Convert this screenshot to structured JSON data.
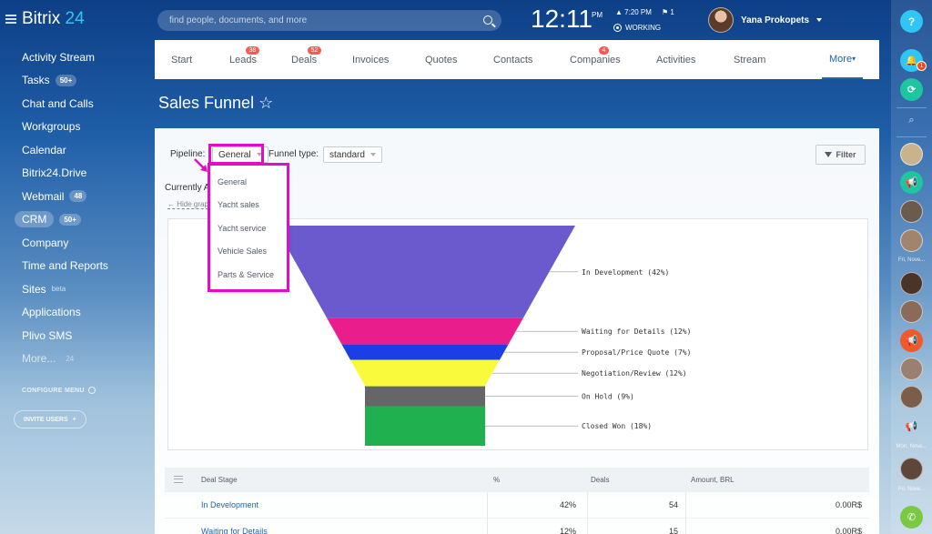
{
  "brand": {
    "name": "Bitrix",
    "num": "24"
  },
  "sidebar": {
    "items": [
      {
        "label": "Activity Stream"
      },
      {
        "label": "Tasks",
        "count": "50+"
      },
      {
        "label": "Chat and Calls"
      },
      {
        "label": "Workgroups"
      },
      {
        "label": "Calendar"
      },
      {
        "label": "Bitrix24.Drive"
      },
      {
        "label": "Webmail",
        "count": "48"
      },
      {
        "label": "CRM",
        "count": "50+",
        "active": true
      },
      {
        "label": "Company"
      },
      {
        "label": "Time and Reports"
      },
      {
        "label": "Sites",
        "sup": "beta"
      },
      {
        "label": "Applications"
      },
      {
        "label": "Plivo SMS"
      },
      {
        "label": "More...",
        "count": "24"
      }
    ],
    "configure": "CONFIGURE MENU",
    "invite": "INVITE USERS"
  },
  "header": {
    "search_placeholder": "find people, documents, and more",
    "clock": "12:11",
    "ampm": "PM",
    "status_time": "7:20 PM",
    "flag_count": "1",
    "working": "WORKING",
    "user_name": "Yana Prokopets"
  },
  "rightbar": {
    "help": "?",
    "notifications_badge": "1",
    "labels": [
      "Fri, Nove...",
      "Mon, Nove...",
      "Fri, Nove..."
    ]
  },
  "tabs": [
    {
      "label": "Start"
    },
    {
      "label": "Leads",
      "badge": "38"
    },
    {
      "label": "Deals",
      "badge": "52"
    },
    {
      "label": "Invoices"
    },
    {
      "label": "Quotes"
    },
    {
      "label": "Contacts"
    },
    {
      "label": "Companies",
      "badge": "4"
    },
    {
      "label": "Activities"
    },
    {
      "label": "Stream"
    },
    {
      "label": "More"
    }
  ],
  "page": {
    "title": "Sales Funnel",
    "star": "☆",
    "pipeline_label": "Pipeline:",
    "pipeline_value": "General",
    "funnel_type_label": "Funnel type:",
    "funnel_type_value": "standard",
    "filter": "Filter",
    "currently": "Currently A",
    "hide_graph": "Hide grap"
  },
  "dropdown": {
    "options": [
      "General",
      "Yacht sales",
      "Yacht service",
      "Vehicle Sales",
      "Parts & Service"
    ],
    "highlight_color": "#e00fc4"
  },
  "chart_data": {
    "type": "funnel",
    "stages": [
      {
        "name": "In Development",
        "label": "In Development (42%)",
        "percent": 42,
        "color": "#6a5acd"
      },
      {
        "name": "Waiting for Details",
        "label": "Waiting for Details (12%)",
        "percent": 12,
        "color": "#e91e8c"
      },
      {
        "name": "Proposal/Price Quote",
        "label": "Proposal/Price Quote (7%)",
        "percent": 7,
        "color": "#1a3fe6"
      },
      {
        "name": "Negotiation/Review",
        "label": "Negotiation/Review (12%)",
        "percent": 12,
        "color": "#fafa3c"
      },
      {
        "name": "On Hold",
        "label": "On Hold (9%)",
        "percent": 9,
        "color": "#666666"
      },
      {
        "name": "Closed Won",
        "label": "Closed Won (18%)",
        "percent": 18,
        "color": "#21b04f"
      }
    ]
  },
  "table": {
    "headers": [
      "Deal Stage",
      "%",
      "Deals",
      "Amount, BRL"
    ],
    "rows": [
      {
        "stage": "In Development",
        "percent": "42%",
        "deals": "54",
        "amount": "0.00R$"
      },
      {
        "stage": "Waiting for Details",
        "percent": "12%",
        "deals": "15",
        "amount": "0.00R$"
      }
    ]
  }
}
